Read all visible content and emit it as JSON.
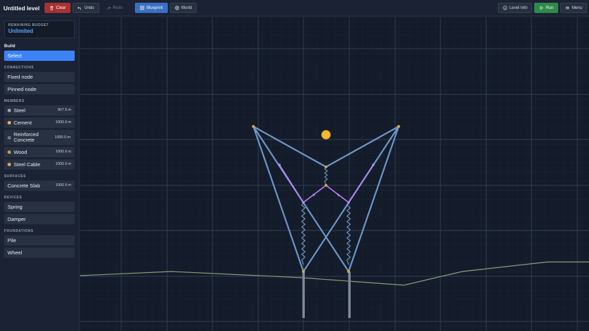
{
  "toolbar": {
    "title": "Untitled level",
    "clear": "Clear",
    "undo": "Undo",
    "redo": "Redo",
    "blueprint": "Blueprint",
    "world": "World",
    "level_info": "Level Info",
    "run": "Run",
    "menu": "Menu"
  },
  "sidebar": {
    "budget_label": "REMAINING BUDGET",
    "budget_value": "Unlimited",
    "build_title": "Build",
    "select": "Select",
    "connections_head": "CONNECTIONS",
    "connections": [
      {
        "label": "Fixed node"
      },
      {
        "label": "Pinned node"
      }
    ],
    "members_head": "MEMBERS",
    "members": [
      {
        "label": "Steel",
        "amount": "907.5 m",
        "color": "#9aa4b3"
      },
      {
        "label": "Cement",
        "amount": "1000.0 m",
        "color": "#e3b55a"
      },
      {
        "label": "Reinforced Concrete",
        "amount": "1000.0 m",
        "color": "#6f7a86"
      },
      {
        "label": "Wood",
        "amount": "1000.0 m",
        "color": "#d39552"
      },
      {
        "label": "Steel Cable",
        "amount": "1000.0 m",
        "color": "#e3a64f"
      }
    ],
    "surfaces_head": "SURFACES",
    "surfaces": [
      {
        "label": "Concrete Slab",
        "amount": "1000.0 m"
      }
    ],
    "devices_head": "DEVICES",
    "devices": [
      {
        "label": "Spring"
      },
      {
        "label": "Damper"
      }
    ],
    "foundations_head": "FOUNDATIONS",
    "foundations": [
      {
        "label": "Pile"
      },
      {
        "label": "Wheel"
      }
    ]
  },
  "colors": {
    "accent": "#3b82f6",
    "member": "#6f98c9",
    "cable": "#c084fc",
    "node": "#d9a441",
    "ground": "#8ca07a",
    "sun": "#f5b82e"
  }
}
